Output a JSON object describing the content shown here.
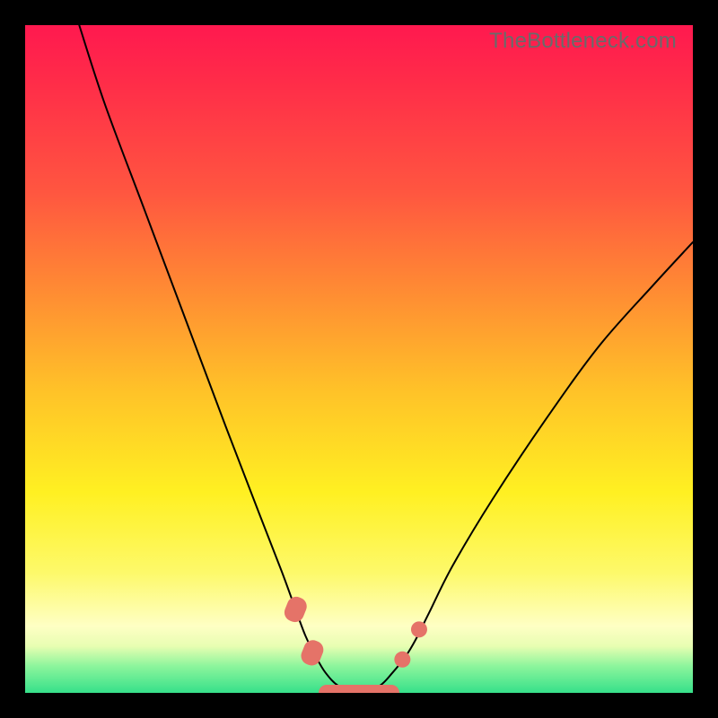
{
  "watermark": "TheBottleneck.com",
  "chart_data": {
    "type": "line",
    "title": "",
    "xlabel": "",
    "ylabel": "",
    "x_range": [
      0,
      100
    ],
    "y_range": [
      0,
      100
    ],
    "note": "Axes are unlabeled; values below are relative percentages of the plot area derived from pixel positions. Curve depicts a V-shaped function reaching ~0 near x≈50 and rising steeply on both sides (steeper on the left).",
    "series": [
      {
        "name": "bottleneck-curve",
        "color": "#000000",
        "x": [
          8.1,
          12.0,
          18.0,
          24.0,
          30.0,
          35.0,
          38.5,
          40.5,
          42.0,
          43.5,
          45.0,
          47.0,
          50.0,
          53.0,
          55.0,
          57.0,
          58.5,
          60.5,
          64.0,
          70.0,
          78.0,
          86.0,
          94.0,
          100.0
        ],
        "y": [
          100.0,
          88.0,
          72.0,
          56.0,
          40.0,
          27.0,
          18.0,
          12.5,
          8.5,
          5.5,
          3.0,
          1.0,
          0.0,
          1.0,
          3.0,
          5.5,
          8.0,
          12.0,
          19.0,
          29.0,
          41.0,
          52.0,
          61.0,
          67.5
        ]
      }
    ],
    "markers": [
      {
        "name": "bead-left-upper",
        "x": 40.5,
        "y": 12.5,
        "shape": "pill",
        "color": "#e57368"
      },
      {
        "name": "bead-left-lower",
        "x": 43.0,
        "y": 6.0,
        "shape": "pill",
        "color": "#e57368"
      },
      {
        "name": "bead-bottom-plateau",
        "x": 50.0,
        "y": 0.0,
        "shape": "long-pill",
        "color": "#e57368"
      },
      {
        "name": "bead-right-lower",
        "x": 56.5,
        "y": 5.0,
        "shape": "dot",
        "color": "#e57368"
      },
      {
        "name": "bead-right-upper",
        "x": 59.0,
        "y": 9.5,
        "shape": "dot",
        "color": "#e57368"
      }
    ],
    "background_gradient": {
      "direction": "top-to-bottom",
      "stops": [
        {
          "pos": 0.0,
          "color": "#ff194f"
        },
        {
          "pos": 0.25,
          "color": "#ff5640"
        },
        {
          "pos": 0.55,
          "color": "#ffc328"
        },
        {
          "pos": 0.82,
          "color": "#fdf96a"
        },
        {
          "pos": 0.93,
          "color": "#e8feb2"
        },
        {
          "pos": 1.0,
          "color": "#36e08a"
        }
      ]
    }
  }
}
